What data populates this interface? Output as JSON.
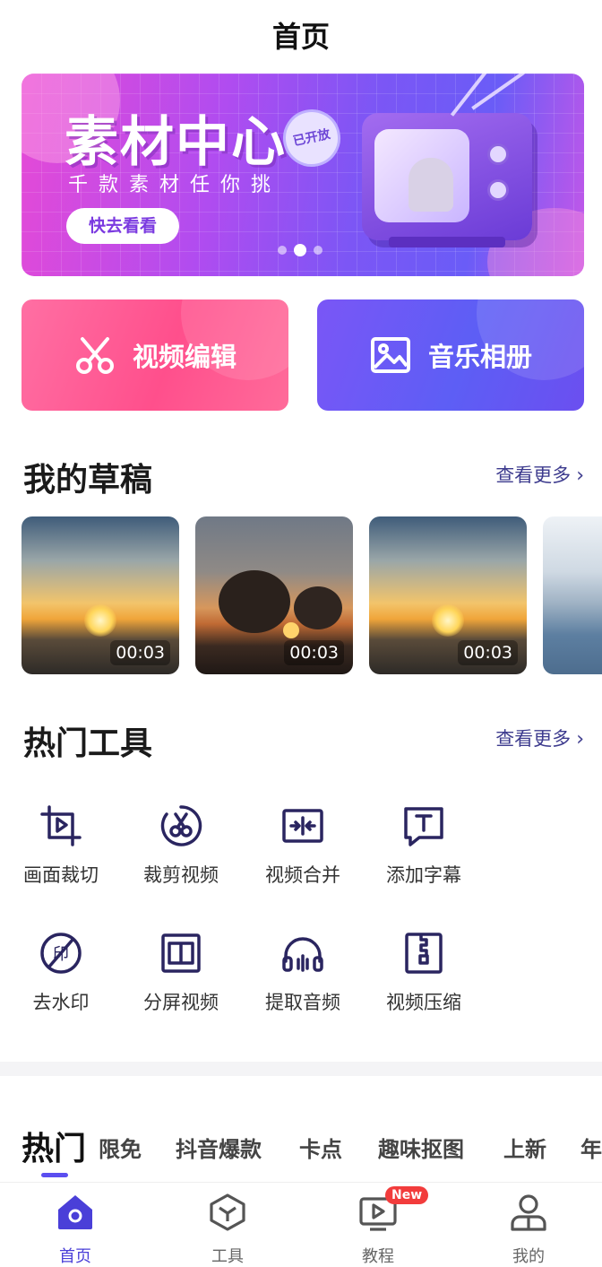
{
  "page": {
    "title": "首页"
  },
  "banner": {
    "title": "素材中心",
    "subtitle": "千款素材任你挑",
    "button_label": "快去看看",
    "seal_text": "已开放",
    "dots": 3,
    "active_dot": 1
  },
  "features": [
    {
      "label": "视频编辑",
      "icon": "scissors-icon"
    },
    {
      "label": "音乐相册",
      "icon": "image-icon"
    }
  ],
  "drafts": {
    "title": "我的草稿",
    "see_more": "查看更多",
    "items": [
      {
        "duration": "00:03"
      },
      {
        "duration": "00:03"
      },
      {
        "duration": "00:03"
      }
    ]
  },
  "tools": {
    "title": "热门工具",
    "see_more": "查看更多",
    "items": [
      {
        "label": "画面裁切",
        "icon": "crop-icon"
      },
      {
        "label": "裁剪视频",
        "icon": "cut-video-icon"
      },
      {
        "label": "视频合并",
        "icon": "merge-icon"
      },
      {
        "label": "添加字幕",
        "icon": "subtitle-icon"
      },
      {
        "label": "去水印",
        "icon": "watermark-remove-icon"
      },
      {
        "label": "分屏视频",
        "icon": "split-screen-icon"
      },
      {
        "label": "提取音频",
        "icon": "headphones-icon"
      },
      {
        "label": "视频压缩",
        "icon": "compress-icon"
      }
    ]
  },
  "categories": {
    "active": "热门",
    "items": [
      "热门",
      "限免",
      "抖音爆款",
      "卡点",
      "趣味抠图",
      "上新",
      "年"
    ]
  },
  "bottom_nav": {
    "items": [
      {
        "label": "首页",
        "icon": "home-icon"
      },
      {
        "label": "工具",
        "icon": "box-icon"
      },
      {
        "label": "教程",
        "icon": "tutorial-icon",
        "badge": "New"
      },
      {
        "label": "我的",
        "icon": "user-icon"
      }
    ]
  },
  "colors": {
    "accent": "#4a3fd8",
    "pink": "#ff5b93",
    "purple": "#6a56f5",
    "badge": "#f23c3c"
  }
}
